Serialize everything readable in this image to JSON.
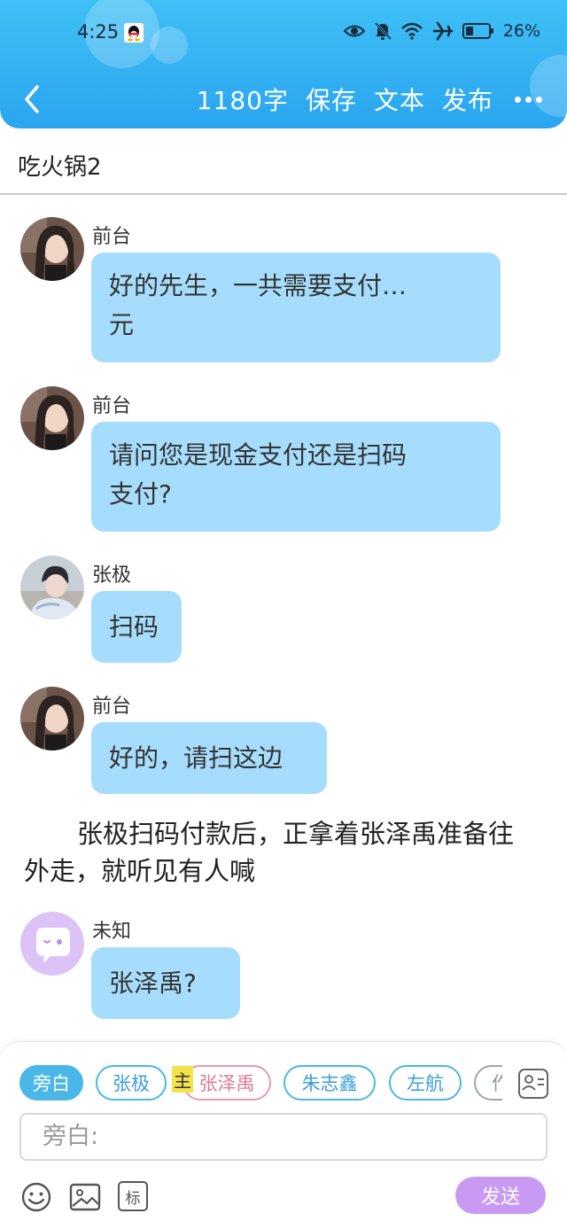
{
  "status_bar": {
    "time": "4:25",
    "battery": "26%",
    "icons": [
      "qq-penguin-icon",
      "eye-icon",
      "mute-bell-icon",
      "wifi-icon",
      "airplane-icon",
      "battery-icon"
    ]
  },
  "header": {
    "back_icon": "chevron-left-icon",
    "word_count": "1180字",
    "save_label": "保存",
    "text_label": "文本",
    "publish_label": "发布",
    "more_icon": "more-dots-icon",
    "gradient_colors": [
      "#3fc0f5",
      "#2aa5f0"
    ]
  },
  "document": {
    "title": "吃火锅2"
  },
  "messages": [
    {
      "speaker": "前台",
      "text_line1": "好的先生，一共需要支付…",
      "text_line2": "元",
      "avatar": "avatar-girl"
    },
    {
      "speaker": "前台",
      "text_line1": "请问您是现金支付还是扫码",
      "text_line2": "支付?",
      "avatar": "avatar-girl"
    },
    {
      "speaker": "张极",
      "text_line1": "扫码",
      "avatar": "avatar-boy"
    },
    {
      "speaker": "前台",
      "text_line1": "好的，请扫这边",
      "avatar": "avatar-girl"
    },
    {
      "speaker": "未知",
      "text_line1": "张泽禹?",
      "avatar": "avatar-unknown"
    }
  ],
  "narration": {
    "text": "张极扫码付款后，正拿着张泽禹准备往外走，就听见有人喊"
  },
  "composer": {
    "chips": [
      "旁白",
      "张极",
      "张泽禹",
      "朱志鑫",
      "左航",
      "作"
    ],
    "main_tag": "主",
    "placeholder": "旁白:",
    "send_label": "发送",
    "tag_tool_label": "标",
    "icons": [
      "emoji-icon",
      "image-icon",
      "tag-icon",
      "contact-card-icon"
    ],
    "colors": {
      "chip_active": "#4ab7e8",
      "send": "#c99af3",
      "bubble": "#a6ddfc"
    }
  }
}
